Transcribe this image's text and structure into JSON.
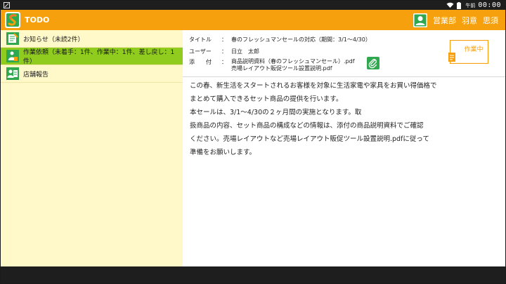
{
  "status_bar": {
    "ampm": "午前",
    "time": "00:00"
  },
  "app": {
    "title": "TODO",
    "user": {
      "department": "営業部",
      "last_name": "羽意",
      "first_name": "思須"
    }
  },
  "sidebar": {
    "items": [
      {
        "label": "お知らせ（未読2件）",
        "icon": "notice-icon",
        "active": false
      },
      {
        "label": "作業依頼（未着手：1件、作業中：1件、差し戻し：1件）",
        "icon": "work-request-icon",
        "active": true
      },
      {
        "label": "店舗報告",
        "icon": "store-report-icon",
        "active": false
      }
    ]
  },
  "task": {
    "title_label": "タイトル",
    "title_value": "春のフレッシュマンセールの対応（期間：3/1～4/30）",
    "user_label": "ユーザー",
    "user_value": "日立　太郎",
    "attach_label": "添　　付",
    "colon": "：",
    "attachments": [
      "商品説明資料（春のフレッシュマンセール）.pdf",
      "売場レイアウト販促ツール設置説明.pdf"
    ],
    "status_button": "作業中",
    "body_lines": [
      "この春、新生活をスタートされるお客様を対象に生活家電や家具をお買い得価格で",
      "まとめて購入できるセット商品の提供を行います。",
      "本セールは、3/1～4/30の２ヶ月間の実施となります。取",
      "扱商品の内容、セット商品の構成などの情報は、添付の商品説明資料でご確認",
      "ください。売場レイアウトなど売場レイアウト販促ツール設置説明.pdfに従って",
      "準備をお願いします。"
    ]
  },
  "colors": {
    "accent": "#f7a00e",
    "active": "#8fcc1e",
    "sidebar_bg": "#fff8c8",
    "icon_green": "#2fa84f"
  }
}
